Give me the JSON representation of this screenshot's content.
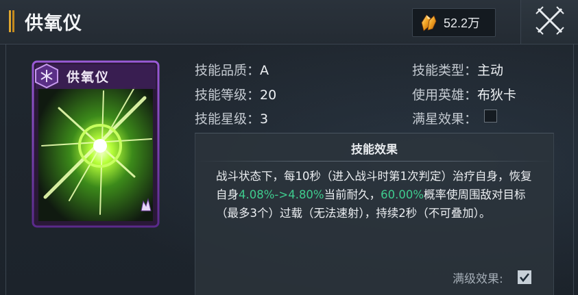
{
  "header": {
    "title": "供氧仪",
    "currency_icon": "crystal-icon",
    "currency_value": "52.2万",
    "close_icon": "close-x-icon"
  },
  "card": {
    "name": "供氧仪",
    "emblem_icon": "hexagon-emblem-icon",
    "rarity_icon": "flame-rarity-icon",
    "frame_color": "#7a3fb8",
    "glow_color": "#b8ff3a"
  },
  "info": {
    "quality_label": "技能品质：",
    "quality_value": "A",
    "level_label": "技能等级：",
    "level_value": "20",
    "star_label": "技能星级：",
    "star_value": "3",
    "type_label": "技能类型：",
    "type_value": "主动",
    "hero_label": "使用英雄：",
    "hero_value": "布狄卡",
    "fullstar_label": "满星效果：",
    "fullstar_checked": false
  },
  "effect": {
    "title": "技能效果",
    "text_1": "战斗状态下，每10秒（进入战斗时第1次判定）治疗自身，恢复自身",
    "hl_1": "4.08%->4.80%",
    "text_2": "当前耐久，",
    "hl_2": "60.00%",
    "text_3": "概率使周围敌对目标（最多3个）过载（无法速射），持续2秒（不可叠加）。",
    "highlight_color": "#3fcc8e",
    "max_label": "满级效果:",
    "max_checked": true
  }
}
